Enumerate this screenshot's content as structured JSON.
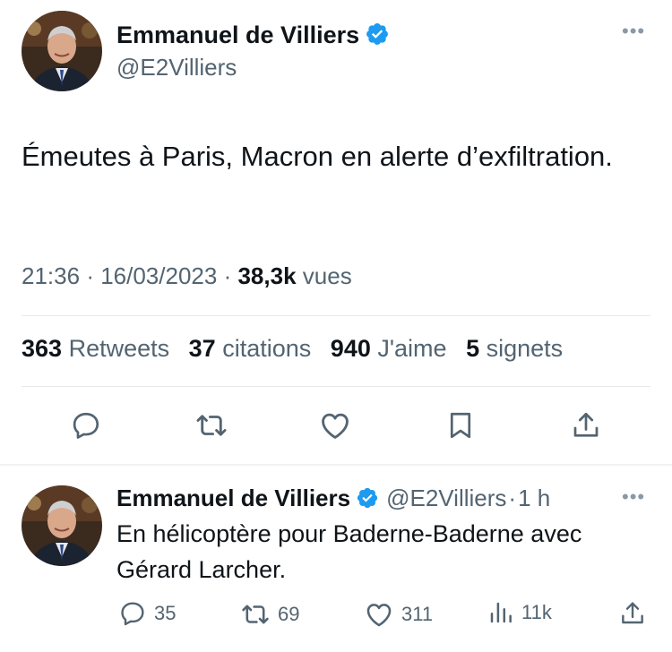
{
  "main_tweet": {
    "author_name": "Emmanuel de Villiers",
    "author_handle": "@E2Villiers",
    "text": "Émeutes à Paris, Macron en alerte d’exfiltration.",
    "time": "21:36",
    "date": "16/03/2023",
    "views_count": "38,3k",
    "views_label": "vues",
    "stats": {
      "retweets_count": "363",
      "retweets_label": "Retweets",
      "quotes_count": "37",
      "quotes_label": "citations",
      "likes_count": "940",
      "likes_label": "J'aime",
      "bookmarks_count": "5",
      "bookmarks_label": "signets"
    }
  },
  "reply": {
    "author_name": "Emmanuel de Villiers",
    "author_handle": "@E2Villiers",
    "time_ago": "1 h",
    "text": "En hélicoptère pour Baderne-Baderne avec Gérard Larcher.",
    "replies": "35",
    "retweets": "69",
    "likes": "311",
    "views": "11k"
  },
  "colors": {
    "verified": "#1d9bf0",
    "secondary_text": "#536471",
    "primary_text": "#0f1419"
  }
}
